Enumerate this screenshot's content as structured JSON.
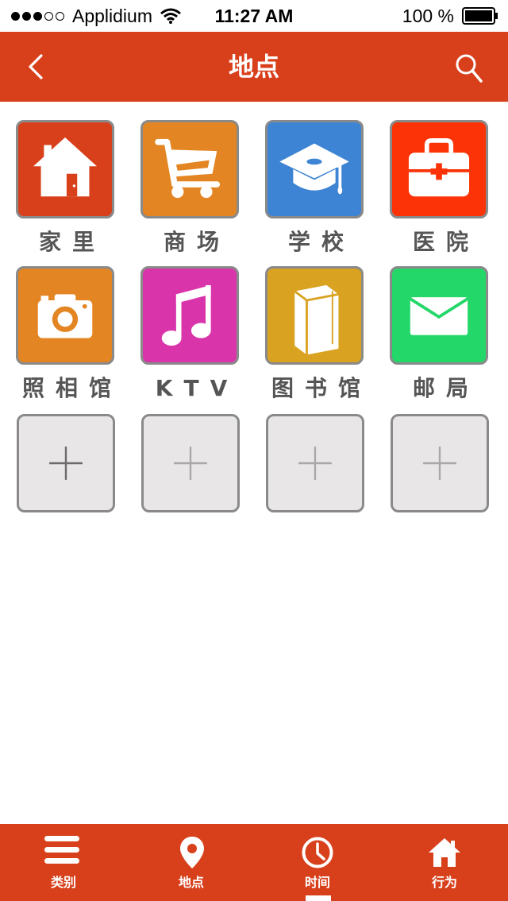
{
  "status_bar": {
    "carrier": "Applidium",
    "time": "11:27 AM",
    "battery": "100 %",
    "signal_bars_filled": 3,
    "signal_bars_total": 5
  },
  "nav": {
    "title": "地点",
    "back_icon": "chevron-left-icon",
    "search_icon": "search-icon"
  },
  "places": [
    {
      "label": "家里",
      "icon": "house-icon",
      "color": "#d8401c"
    },
    {
      "label": "商场",
      "icon": "shopping-cart-icon",
      "color": "#e38522"
    },
    {
      "label": "学校",
      "icon": "graduation-cap-icon",
      "color": "#3d84d4"
    },
    {
      "label": "医院",
      "icon": "first-aid-kit-icon",
      "color": "#fb3306"
    },
    {
      "label": "照相馆",
      "icon": "camera-icon",
      "color": "#e38522"
    },
    {
      "label": "KTV",
      "icon": "music-note-icon",
      "color": "#da34ab"
    },
    {
      "label": "图书馆",
      "icon": "book-icon",
      "color": "#d9a221"
    },
    {
      "label": "邮局",
      "icon": "envelope-icon",
      "color": "#23d768"
    }
  ],
  "add_slots": [
    {
      "icon": "plus-icon"
    },
    {
      "icon": "plus-icon"
    },
    {
      "icon": "plus-icon"
    },
    {
      "icon": "plus-icon"
    }
  ],
  "tabs": [
    {
      "label": "类别",
      "icon": "menu-icon"
    },
    {
      "label": "地点",
      "icon": "location-pin-icon"
    },
    {
      "label": "时间",
      "icon": "clock-icon",
      "active": true
    },
    {
      "label": "行为",
      "icon": "home-icon"
    }
  ],
  "colors": {
    "brand": "#d8401c",
    "label_text": "#555555",
    "tile_border": "#8a8a8a",
    "add_tile_bg": "#e8e6e6"
  }
}
